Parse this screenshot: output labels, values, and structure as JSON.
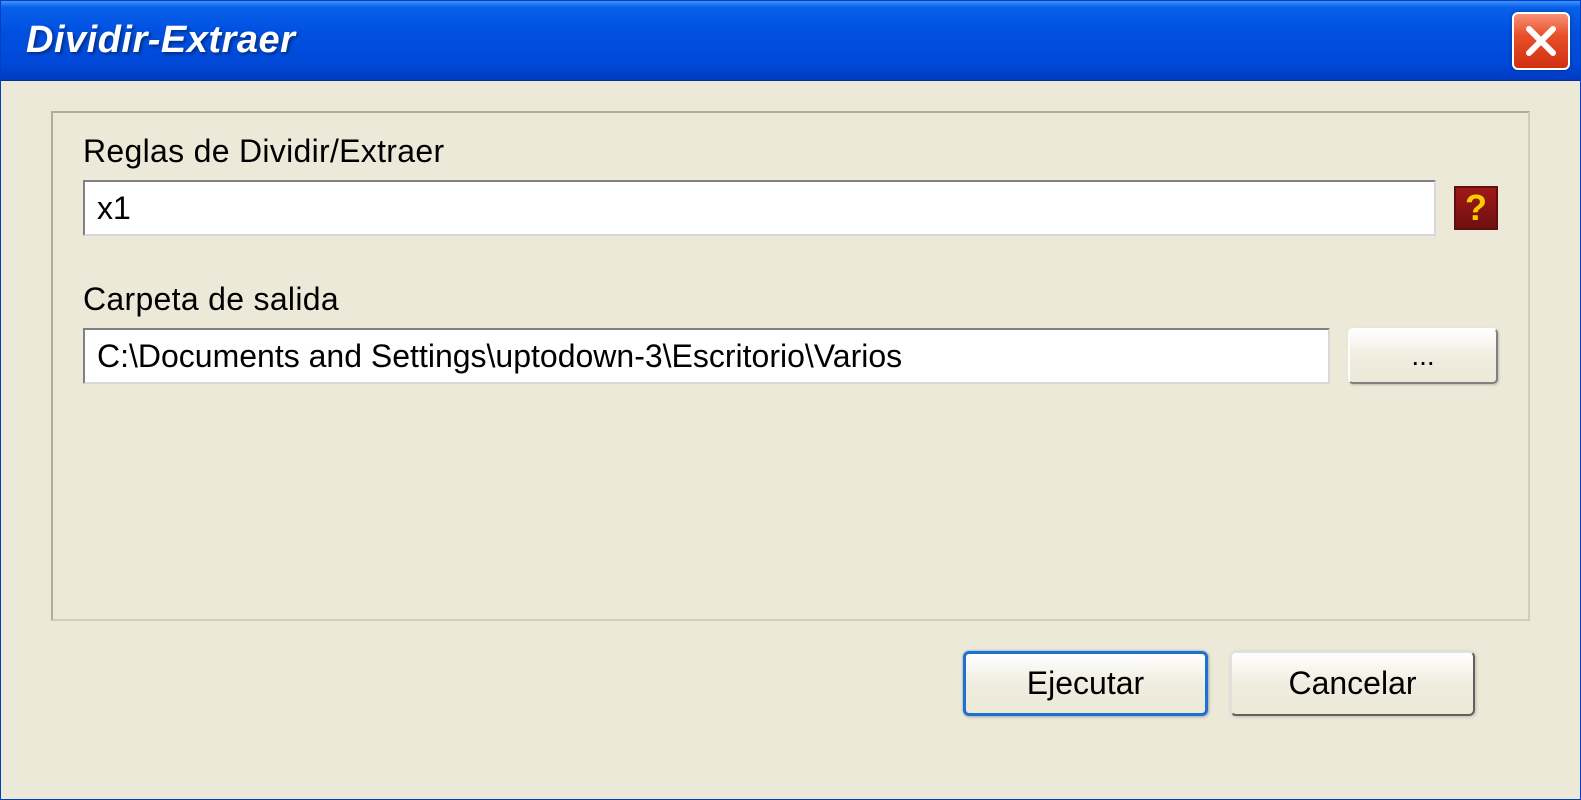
{
  "window": {
    "title": "Dividir-Extraer"
  },
  "form": {
    "rules": {
      "label": "Reglas de Dividir/Extraer",
      "value": "x1"
    },
    "output_folder": {
      "label": "Carpeta de salida",
      "value": "C:\\Documents and Settings\\uptodown-3\\Escritorio\\Varios",
      "browse_label": "..."
    }
  },
  "buttons": {
    "execute": "Ejecutar",
    "cancel": "Cancelar"
  }
}
